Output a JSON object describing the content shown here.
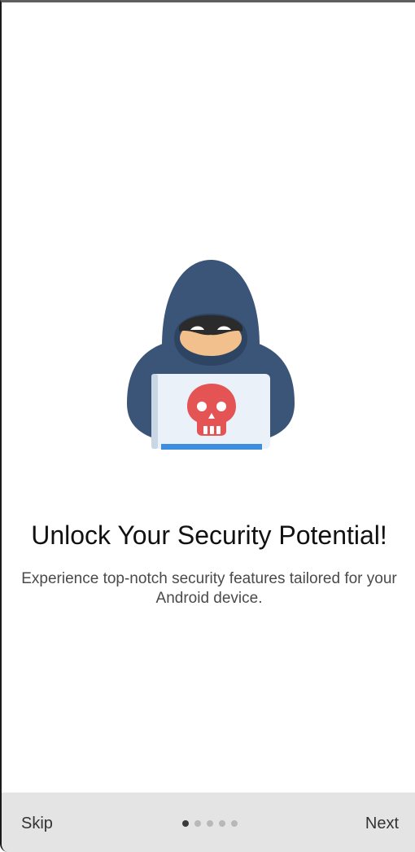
{
  "onboarding": {
    "title": "Unlock Your Security Potential!",
    "subtitle": "Experience top-notch security features tailored for your Android device.",
    "illustration": "hacker-with-laptop-skull-illustration"
  },
  "nav": {
    "skip_label": "Skip",
    "next_label": "Next",
    "page_count": 5,
    "current_page": 1
  },
  "colors": {
    "hood": "#3a5578",
    "hood_dark": "#2d4463",
    "face": "#f1c08d",
    "mask": "#2b2b2b",
    "laptop": "#eaf1f9",
    "laptop_bar": "#3e8ee0",
    "skull": "#e55454",
    "bottom_bar": "#e4e4e4"
  }
}
